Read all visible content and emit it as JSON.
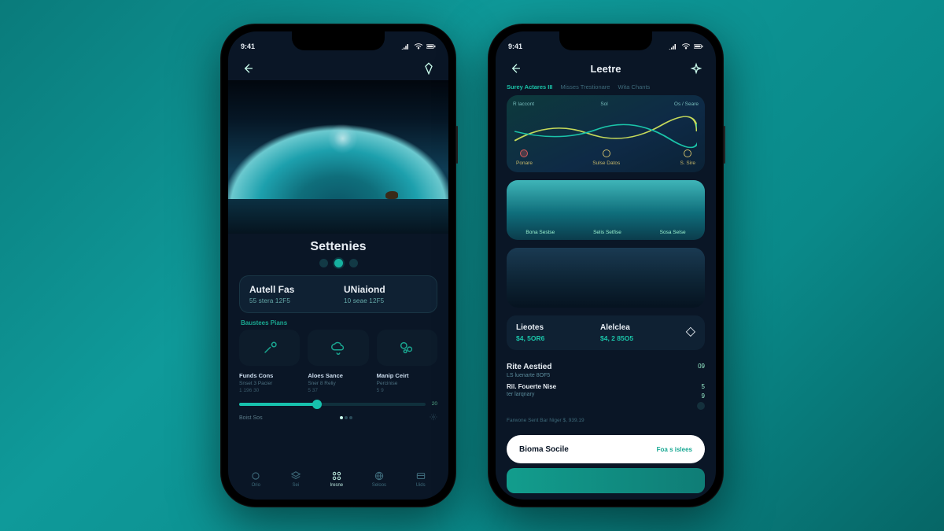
{
  "colors": {
    "accent": "#17c1ad",
    "bg": "#0a1626",
    "card": "#0f2133"
  },
  "status": {
    "time": "9:41"
  },
  "phone1": {
    "title": "Settenies",
    "stats": [
      {
        "label": "Autell Fas",
        "value": "55 stera 12F5"
      },
      {
        "label": "UNiaiond",
        "value": "10 seae 12F5"
      }
    ],
    "section_label": "Baustees Pians",
    "columns": [
      {
        "t1": "Funds Cons",
        "t2": "Snset 3 Pacier",
        "t3": "1 196 30"
      },
      {
        "t1": "Aloes Sance",
        "t2": "Sner 8 Reliy",
        "t3": "5 37"
      },
      {
        "t1": "Manip Ceirt",
        "t2": "Percinise",
        "t3": "5 9"
      }
    ],
    "slider": {
      "caption": "20"
    },
    "footer_label": "Boist Sos",
    "tabs": [
      "Orio",
      "Sei",
      "Iresne",
      "Seloos",
      "Uids"
    ]
  },
  "phone2": {
    "title": "Leetre",
    "top_tabs": [
      "Surey Actares III",
      "Misses Trestionare",
      "Wita Chants"
    ],
    "chart": {
      "top_left": "R laccont",
      "top_mid": "Sol",
      "top_right": "Os / Seare",
      "points": [
        "Ponare",
        "Sulse Datos",
        "S. Sire"
      ]
    },
    "card1_labels": [
      "Bona Sestse",
      "Selis Setfise",
      "Sosa Selse"
    ],
    "kv": [
      {
        "k": "Lieotes",
        "v": "$4, 5OR6"
      },
      {
        "k": "Alelclea",
        "v": "$4, 2 85O5"
      }
    ],
    "list": [
      {
        "l1": "Rite Aestied",
        "l2": "LS luenarte 8OF5",
        "r": "09"
      },
      {
        "l1": "Ril. Fouerte Nise",
        "l2": "ter larqnary",
        "r": "5"
      },
      {
        "l1": "",
        "l2": "",
        "r": "9"
      }
    ],
    "meta": "Farwone Sent Bar Niger $, 939.19",
    "cta": {
      "left": "Bioma Socile",
      "right": "Foa s islees"
    }
  }
}
